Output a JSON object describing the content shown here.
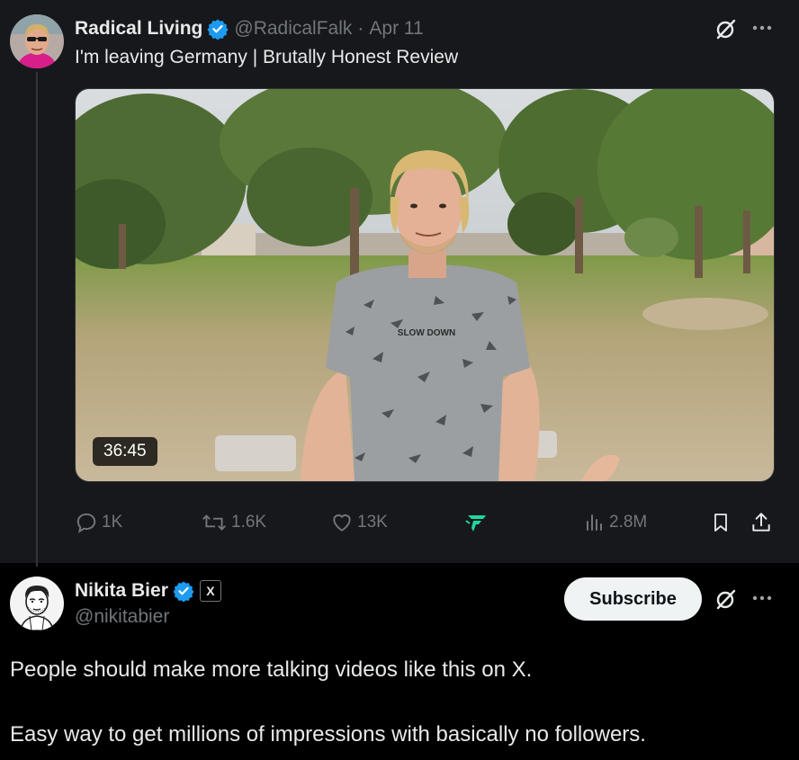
{
  "parent_post": {
    "author_name": "Radical Living",
    "handle": "@RadicalFalk",
    "separator": "·",
    "date": "Apr 11",
    "text": "I'm leaving Germany | Brutally Honest Review",
    "video": {
      "duration": "36:45",
      "shirt_text": "SLOW DOWN"
    },
    "actions": {
      "replies": "1K",
      "reposts": "1.6K",
      "likes": "13K",
      "views": "2.8M"
    }
  },
  "reply_post": {
    "author_name": "Nikita Bier",
    "affiliate_badge": "X",
    "handle": "@nikitabier",
    "subscribe_label": "Subscribe",
    "paragraphs": [
      "People should make more talking videos like this on X.",
      "Easy way to get millions of impressions with basically no followers."
    ]
  },
  "colors": {
    "background": "#000000",
    "parent_background": "#16181c",
    "text": "#e7e9ea",
    "muted": "#71767b",
    "verified": "#1d9bf0",
    "grok_accent": "#1ed7a2",
    "subscribe_bg": "#eff3f4"
  },
  "icons": [
    "verified-icon",
    "grok-icon",
    "more-icon",
    "reply-icon",
    "repost-icon",
    "like-icon",
    "brand-icon",
    "views-icon",
    "bookmark-icon",
    "share-icon",
    "x-logo-icon"
  ]
}
